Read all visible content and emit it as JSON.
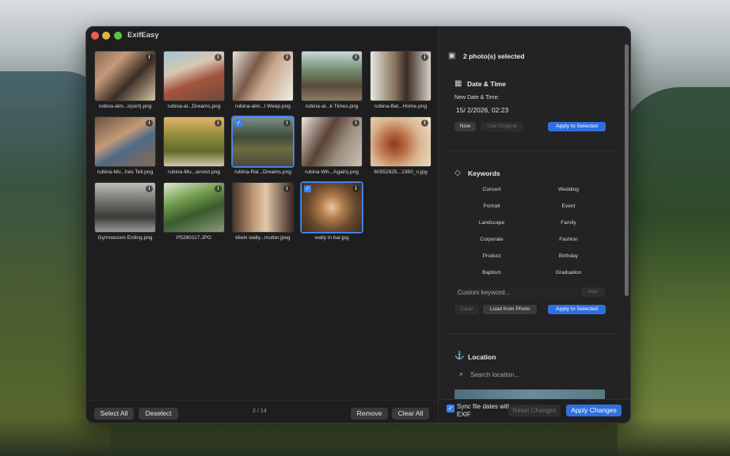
{
  "app": {
    "title": "ExifEasy"
  },
  "photos": [
    {
      "name": "rubina-alm...irport).png",
      "selected": false
    },
    {
      "name": "rubina-al...Dreams.png",
      "selected": false
    },
    {
      "name": "rubina-alm...l Weep.png",
      "selected": false
    },
    {
      "name": "rubina-al...k Times.png",
      "selected": false
    },
    {
      "name": "rubina-Bet...Home.png",
      "selected": false
    },
    {
      "name": "rubina-Mu...hes Tell.png",
      "selected": false
    },
    {
      "name": "rubina-Mu...arvest.png",
      "selected": false
    },
    {
      "name": "rubina-Rai...Dreams.png",
      "selected": true
    },
    {
      "name": "rubina-Wh...Again).png",
      "selected": false
    },
    {
      "name": "60552825...1360_n.jpg",
      "selected": false
    },
    {
      "name": "Gymnasium Erding.png",
      "selected": false
    },
    {
      "name": "P5280117.JPG",
      "selected": false
    },
    {
      "name": "kliein wally...mutter.jpeg",
      "selected": false
    },
    {
      "name": "wally in bar.jpg",
      "selected": true
    }
  ],
  "bottom_bar": {
    "select_all": "Select All",
    "deselect": "Deselect",
    "counter": "2 / 14",
    "remove": "Remove",
    "clear_all": "Clear All"
  },
  "panel": {
    "header": "2 photo(s) selected",
    "date_time": {
      "title": "Date & Time",
      "label": "New Date & Time:",
      "value": "15/  2/2026, 02:23",
      "now": "Now",
      "use_original": "Use Original",
      "apply": "Apply to Selected"
    },
    "keywords": {
      "title": "Keywords",
      "items": [
        "Concert",
        "Wedding",
        "Portrait",
        "Event",
        "Landscape",
        "Family",
        "Corporate",
        "Fashion",
        "Product",
        "Birthday",
        "Baptism",
        "Graduation"
      ],
      "custom_placeholder": "Custom keyword...",
      "add": "Add",
      "clear": "Clear",
      "load": "Load from Photo",
      "apply": "Apply to Selected"
    },
    "location": {
      "title": "Location",
      "search_placeholder": "Search location..."
    }
  },
  "footer": {
    "sync_label": "Sync file dates with EXIF",
    "sync_checked": true,
    "reset": "Reset Changes",
    "apply": "Apply Changes"
  },
  "colors": {
    "accent": "#2f6fe0",
    "window_bg": "#1e1e1e",
    "panel_bg": "#232323"
  }
}
